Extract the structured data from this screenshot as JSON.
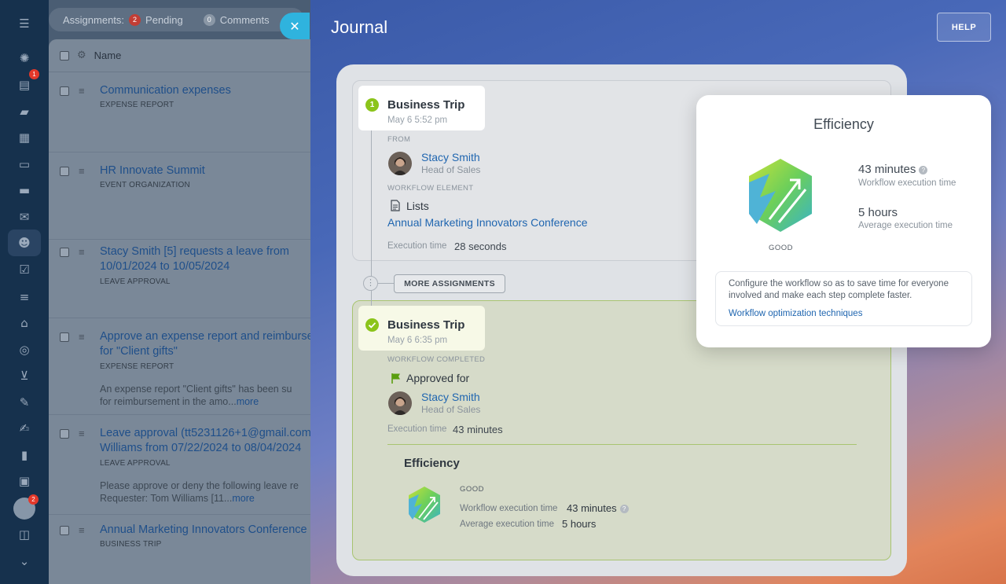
{
  "sidebar": {
    "icons": [
      "menu-icon",
      "sites-icon",
      "feed-icon",
      "chat-icon",
      "calendar-icon",
      "docs-icon",
      "drive-icon",
      "mail-icon",
      "groups-icon",
      "tasks-icon",
      "filter-icon",
      "company-icon",
      "goals-icon",
      "shop-icon",
      "sign-icon",
      "edit-icon",
      "analytics-icon",
      "contacts-icon",
      "box-icon",
      "more-icon"
    ],
    "feed_badge": "1",
    "avatar_badge": "2"
  },
  "list": {
    "pill_label": "Assignments:",
    "pending_count": "2",
    "pending_label": "Pending",
    "comments_count": "0",
    "comments_label": "Comments",
    "header_name": "Name",
    "rows": [
      {
        "title": "Communication expenses",
        "sub": "EXPENSE REPORT"
      },
      {
        "title": "HR Innovate Summit",
        "sub": "EVENT ORGANIZATION"
      },
      {
        "title": "Stacy Smith [5] requests a leave from",
        "title2": "10/01/2024 to 10/05/2024",
        "sub": "LEAVE APPROVAL"
      },
      {
        "title": "Approve an expense report and reimburse",
        "title2": "for \"Client gifts\"",
        "sub": "EXPENSE REPORT",
        "desc": "An expense report \"Client gifts\" has been su",
        "desc2": "for reimbursement in the amo...",
        "more": "more"
      },
      {
        "title": "Leave approval (tt5231126+1@gmail.com",
        "title2": "Williams from 07/22/2024 to 08/04/2024",
        "sub": "LEAVE APPROVAL",
        "desc": "Please approve or deny the following leave re",
        "desc2": "Requester: Tom Williams [11...",
        "more": "more"
      },
      {
        "title": "Annual Marketing Innovators Conference",
        "sub": "BUSINESS TRIP"
      }
    ]
  },
  "journal": {
    "title": "Journal",
    "help_label": "HELP",
    "step1": {
      "number": "1",
      "title": "Business Trip",
      "date": "May 6 5:52 pm",
      "from_label": "FROM",
      "person_name": "Stacy Smith",
      "person_role": "Head of Sales",
      "element_label": "WORKFLOW ELEMENT",
      "element_type": "Lists",
      "element_link": "Annual Marketing Innovators Conference",
      "exec_label": "Execution time",
      "exec_value": "28 seconds"
    },
    "more_label": "MORE ASSIGNMENTS",
    "step2": {
      "title": "Business Trip",
      "date": "May 6 6:35 pm",
      "status_label": "WORKFLOW COMPLETED",
      "approved_label": "Approved for",
      "person_name": "Stacy Smith",
      "person_role": "Head of Sales",
      "exec_label": "Execution time",
      "exec_value": "43 minutes"
    },
    "efficiency_inline": {
      "title": "Efficiency",
      "rating": "GOOD",
      "workflow_label": "Workflow execution time",
      "workflow_value": "43 minutes",
      "average_label": "Average execution time",
      "average_value": "5 hours"
    }
  },
  "efficiency_popup": {
    "title": "Efficiency",
    "workflow_value": "43 minutes",
    "workflow_label": "Workflow execution time",
    "average_value": "5 hours",
    "average_label": "Average execution time",
    "rating": "GOOD",
    "note": "Configure the workflow so as to save time for everyone involved and make each step complete faster.",
    "link": "Workflow optimization techniques"
  },
  "colors": {
    "accent_green": "#8bc41a",
    "link_blue": "#2066b0",
    "close_button": "#2fb3de",
    "badge_red": "#e3382a"
  }
}
